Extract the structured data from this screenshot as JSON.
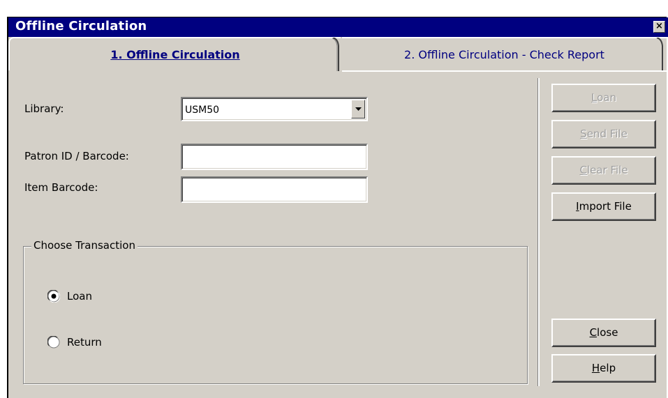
{
  "window": {
    "title": "Offline Circulation",
    "close_glyph": "×"
  },
  "tabs": [
    {
      "label": "1. Offline Circulation",
      "active": true
    },
    {
      "label": "2. Offline Circulation - Check Report",
      "active": false
    }
  ],
  "form": {
    "library_label": "Library:",
    "library_value": "USM50",
    "patron_label": "Patron ID / Barcode:",
    "patron_value": "",
    "item_label": "Item Barcode:",
    "item_value": ""
  },
  "transaction": {
    "group_title": "Choose Transaction",
    "options": [
      {
        "label": "Loan",
        "selected": true
      },
      {
        "label": "Return",
        "selected": false
      }
    ]
  },
  "buttons": {
    "loan": {
      "label": "Loan",
      "accel": "L",
      "rest": "oan",
      "enabled": false
    },
    "send_file": {
      "label": "Send File",
      "accel": "S",
      "rest": "end File",
      "enabled": false
    },
    "clear_file": {
      "label": "Clear File",
      "accel": "C",
      "rest": "lear File",
      "enabled": false
    },
    "import_file": {
      "label": "Import File",
      "accel": "I",
      "rest": "mport File",
      "enabled": true
    },
    "close": {
      "label": "Close",
      "accel": "C",
      "rest": "lose",
      "enabled": true
    },
    "help": {
      "label": "Help",
      "accel": "H",
      "rest": "elp",
      "enabled": true
    }
  },
  "colors": {
    "titlebar": "#000080",
    "face": "#d4d0c8",
    "tab_text": "#000080"
  }
}
